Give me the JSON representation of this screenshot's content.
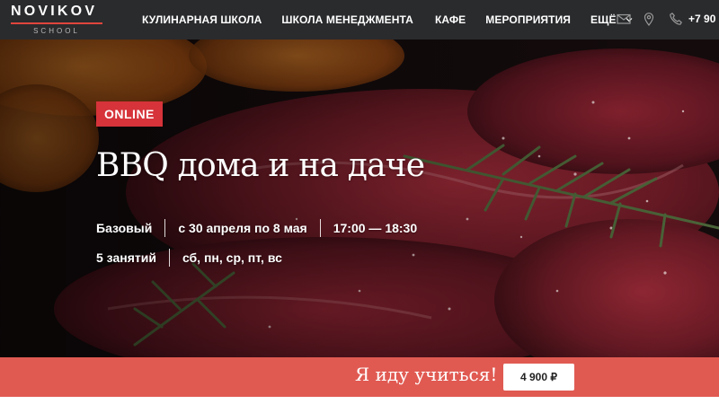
{
  "brand": {
    "name": "NOVIKOV",
    "sub": "SCHOOL"
  },
  "nav": {
    "items": [
      "КУЛИНАРНАЯ ШКОЛА",
      "ШКОЛА МЕНЕДЖМЕНТА",
      "КАФЕ",
      "МЕРОПРИЯТИЯ"
    ],
    "more_label": "ЕЩЁ",
    "phone": "+7 90"
  },
  "icons": [
    "mail-icon",
    "location-pin-icon",
    "phone-icon",
    "chevron-down-icon"
  ],
  "hero": {
    "badge": "ONLINE",
    "title": "BBQ дома и на даче",
    "row1": [
      "Базовый",
      "с 30 апреля по 8 мая",
      "17:00 — 18:30"
    ],
    "row2": [
      "5 занятий",
      "сб, пн, ср, пт, вс"
    ]
  },
  "cta": {
    "label": "Я иду учиться!",
    "price": "4 900 ₽"
  },
  "colors": {
    "header_bg": "#2a2b2d",
    "accent": "#d6333a",
    "cta_bg": "#e05a52"
  }
}
